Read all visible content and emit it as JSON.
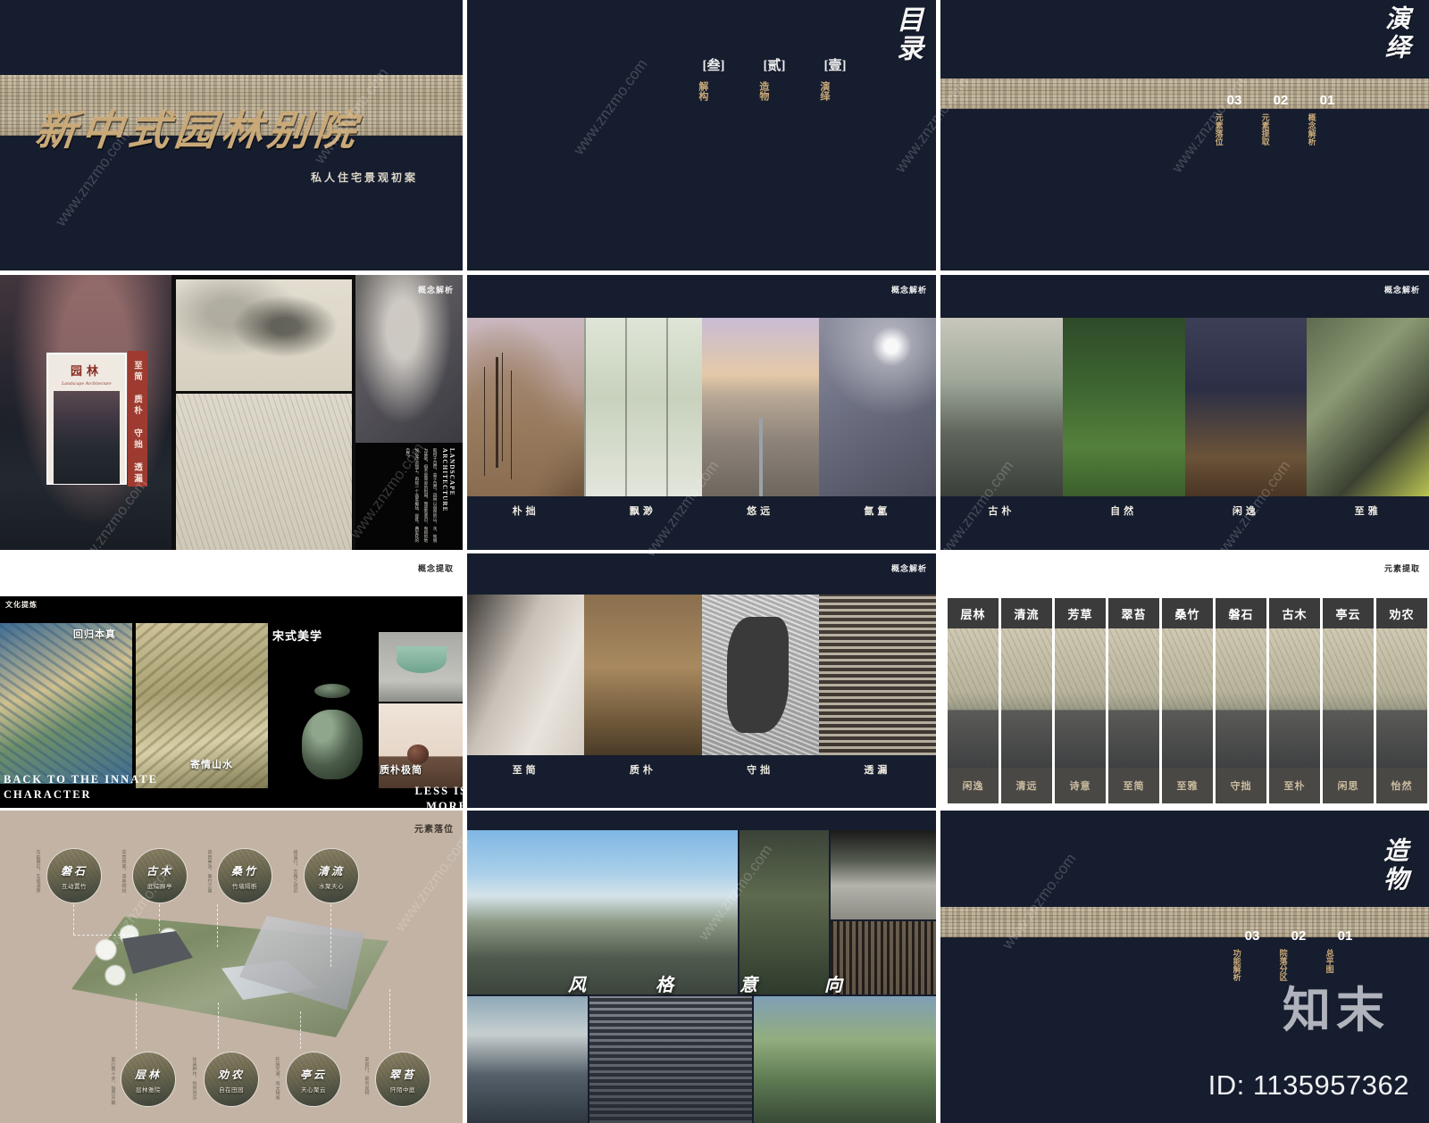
{
  "cover": {
    "title": "新中式园林别院",
    "subtitle": "私人住宅景观初案"
  },
  "toc": {
    "heading": "目录",
    "columns": [
      {
        "num": "[叁]",
        "word": "解构"
      },
      {
        "num": "[贰]",
        "word": "造物"
      },
      {
        "num": "[壹]",
        "word": "演绎"
      }
    ]
  },
  "divider_yanyi": {
    "heading": "演绎",
    "items": [
      {
        "num": "03",
        "label": "元素落位"
      },
      {
        "num": "02",
        "label": "元素提取"
      },
      {
        "num": "01",
        "label": "概念解析"
      }
    ]
  },
  "divider_zaowu": {
    "heading": "造物",
    "items": [
      {
        "num": "03",
        "label": "功能解析"
      },
      {
        "num": "02",
        "label": "院落分区"
      },
      {
        "num": "01",
        "label": "总平图"
      }
    ]
  },
  "collage": {
    "corner_tag": "概念解析",
    "card_title": "园林",
    "card_subtitle": "Landscape Architecture",
    "red_bar": "至简 质朴 守拙 透漏",
    "vertical_title": "LANDSCAPE ARCHITECTURE",
    "vertical_body": "取材于自然、高于自然，园林以自然的山、水、地貌为基础，但不是简单的利用，而是有意识、有目的地加以改造加工，再现一个高度概括、提炼、典型化的自然。"
  },
  "mood_row1": {
    "corner_tag": "概念解析",
    "items": [
      {
        "caption": "朴拙",
        "style": "ph-tree"
      },
      {
        "caption": "飘渺",
        "style": "ph-glass"
      },
      {
        "caption": "悠远",
        "style": "ph-court"
      },
      {
        "caption": "氤氲",
        "style": "ph-fog"
      }
    ]
  },
  "mood_row1b": {
    "corner_tag": "概念解析",
    "items": [
      {
        "caption": "古朴",
        "style": "ph-gupu"
      },
      {
        "caption": "自然",
        "style": "ph-ziran"
      },
      {
        "caption": "闲逸",
        "style": "ph-xianyi"
      },
      {
        "caption": "至雅",
        "style": "ph-zhiya"
      }
    ]
  },
  "mood_row2": {
    "corner_tag": "概念解析",
    "items": [
      {
        "caption": "至简",
        "style": "ph-zhijian"
      },
      {
        "caption": "质朴",
        "style": "ph-zhipu"
      },
      {
        "caption": "守拙",
        "style": "ph-shouzhuo"
      },
      {
        "caption": "透漏",
        "style": "ph-toulou"
      }
    ]
  },
  "culture": {
    "corner_tag": "概念提取",
    "header": "文化提炼",
    "label_top_left": "回归本真",
    "label_bottom_left": "BACK TO THE INNATE CHARACTER",
    "label_painting": "寄情山水",
    "label_top_right": "宋式美学",
    "label_zhipu": "质朴极简",
    "label_less": "LESS IS MORE"
  },
  "element_grid": {
    "corner_tag": "元素提取",
    "columns": [
      {
        "top": "层林",
        "bottom": "闲逸"
      },
      {
        "top": "清流",
        "bottom": "清远"
      },
      {
        "top": "芳草",
        "bottom": "诗意"
      },
      {
        "top": "翠苔",
        "bottom": "至简"
      },
      {
        "top": "桑竹",
        "bottom": "至雅"
      },
      {
        "top": "磐石",
        "bottom": "守拙"
      },
      {
        "top": "古木",
        "bottom": "至朴"
      },
      {
        "top": "亭云",
        "bottom": "闲思"
      },
      {
        "top": "劝农",
        "bottom": "怡然"
      }
    ]
  },
  "site_plan": {
    "corner_tag": "元素落位",
    "nodes_top": [
      {
        "name": "磐石",
        "desc": "互动置竹",
        "side": "东临磐石，互观涵渺"
      },
      {
        "name": "古木",
        "desc": "庭院廊亭",
        "side": "芳草鲜美，落英缤纷"
      },
      {
        "name": "桑竹",
        "desc": "竹墙隔断",
        "side": "良田美池，桑竹之属"
      },
      {
        "name": "清流",
        "desc": "水聚天心",
        "side": "缘溪行，忘路之远近"
      }
    ],
    "nodes_bottom": [
      {
        "name": "层林",
        "desc": "层林雅院",
        "side": "复行数十步，豁然开朗"
      },
      {
        "name": "劝农",
        "desc": "自在田园",
        "side": "往来种作，怡然自乐"
      },
      {
        "name": "亭云",
        "desc": "天心聚云",
        "side": "阡陌交通，鸡犬相闻"
      },
      {
        "name": "翠苔",
        "desc": "阡陌中庭",
        "side": "复前行，欲穷其林"
      }
    ]
  },
  "style_intent": {
    "chars": [
      "风",
      "格",
      "意",
      "向"
    ]
  },
  "watermark": {
    "logo": "知末",
    "id": "ID: 1135957362",
    "site": "www.znzmo.com"
  },
  "colors": {
    "navy": "#161d2e",
    "gold": "#c9a978",
    "red": "#9d3b30",
    "paper": "#c2b3a4"
  }
}
